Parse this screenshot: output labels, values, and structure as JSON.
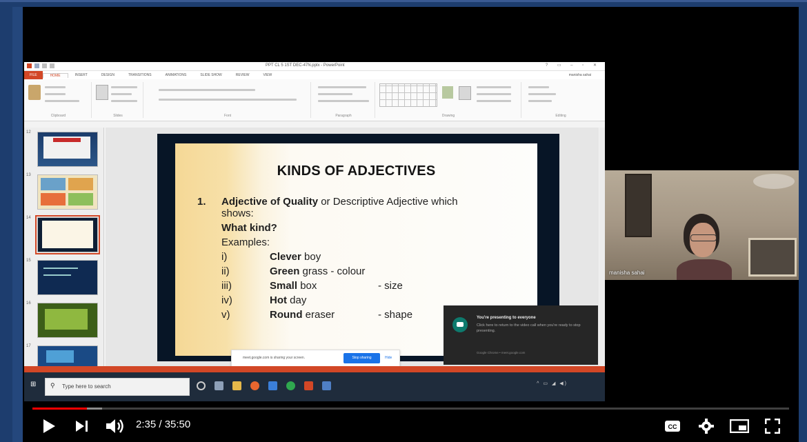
{
  "ppt": {
    "title": "PPT CL 5 1ST DEC-47N.pptx - PowerPoint",
    "tabs": [
      "FILE",
      "HOME",
      "INSERT",
      "DESIGN",
      "TRANSITIONS",
      "ANIMATIONS",
      "SLIDE SHOW",
      "REVIEW",
      "VIEW"
    ],
    "user": "manisha sahai",
    "groups": [
      "Clipboard",
      "Slides",
      "Font",
      "Paragraph",
      "Drawing",
      "Editing"
    ],
    "slide_numbers": [
      "12",
      "13",
      "14",
      "15",
      "16",
      "17"
    ],
    "slide": {
      "title": "KINDS OF ADJECTIVES",
      "item_num": "1.",
      "item_bold": "Adjective of Quality",
      "item_rest": " or Descriptive Adjective which",
      "item_line2": "shows:",
      "question": "What kind?",
      "examples_label": "Examples:",
      "examples": [
        {
          "num": "i)",
          "bold": "Clever",
          "rest": " boy",
          "note": ""
        },
        {
          "num": "ii)",
          "bold": "Green",
          "rest": " grass - colour",
          "note": ""
        },
        {
          "num": "iii)",
          "bold": "Small",
          "rest": " box",
          "note": "- size"
        },
        {
          "num": "iv)",
          "bold": "Hot",
          "rest": " day",
          "note": ""
        },
        {
          "num": "v)",
          "bold": "Round",
          "rest": " eraser",
          "note": "- shape"
        }
      ]
    }
  },
  "share_bar": {
    "message": "meet.google.com is sharing your screen.",
    "stop": "Stop sharing",
    "hide": "Hide"
  },
  "taskbar": {
    "search_placeholder": "Type here to search"
  },
  "participant": {
    "name": "manisha sahai"
  },
  "notification": {
    "title": "You're presenting to everyone",
    "body": "Click here to return to the video call when you're ready to stop presenting.",
    "source": "Google Chrome • meet.google.com"
  },
  "player": {
    "time": "2:35 / 35:50",
    "progress_played": 0.072,
    "progress_buffered": 0.092
  },
  "colors": {
    "progress": "#ff0000",
    "ppt_accent": "#d24726",
    "share_button": "#1a73e8"
  }
}
